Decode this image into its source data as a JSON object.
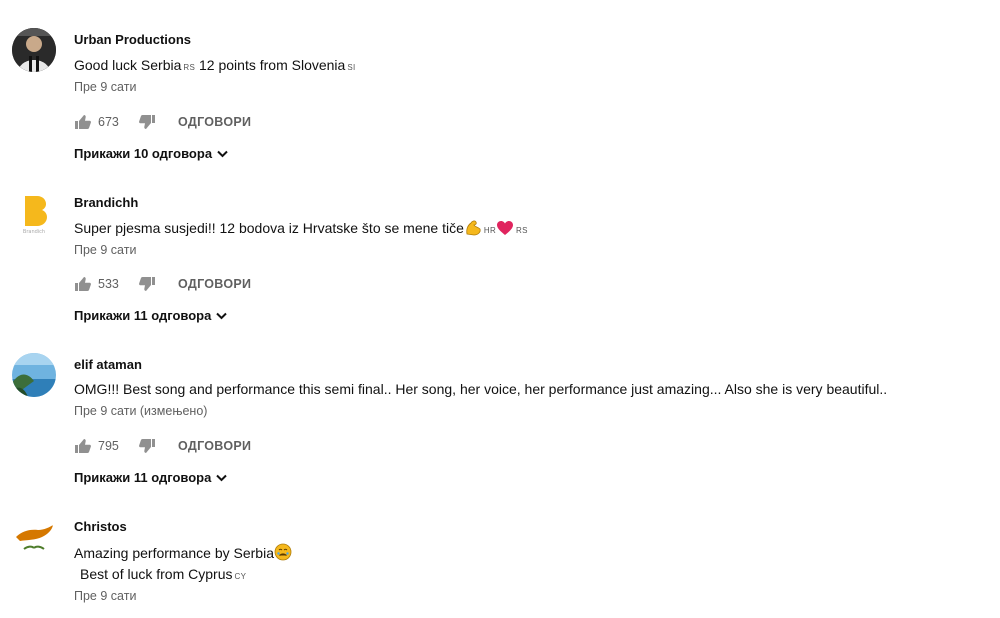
{
  "comments": [
    {
      "author": "Urban Productions",
      "text_parts": [
        "Good luck Serbia",
        "RS",
        " 12 points from Slovenia",
        "SI"
      ],
      "time": "Пре 9 сати",
      "likes": "673",
      "reply_label": "ОДГОВОРИ",
      "replies_label": "Прикажи 10 одговора",
      "avatar_icon": "person-photo-icon"
    },
    {
      "author": "Brandichh",
      "text_parts": [
        "Super pjesma susjedi!! 12 bodova iz Hrvatske što se mene tiče",
        "HR",
        "RS"
      ],
      "time": "Пре 9 сати",
      "likes": "533",
      "reply_label": "ОДГОВОРИ",
      "replies_label": "Прикажи 11 одговора",
      "avatar_icon": "yellow-logo-icon"
    },
    {
      "author": "elif ataman",
      "text": "OMG!!! Best song and performance this semi final.. Her song, her voice, her performance just amazing... Also she is very beautiful..",
      "time": "Пре 9 сати (измењено)",
      "likes": "795",
      "reply_label": "ОДГОВОРИ",
      "replies_label": "Прикажи 11 одговора",
      "avatar_icon": "landscape-photo-icon"
    },
    {
      "author": "Christos",
      "text_line1": "Amazing performance by Serbia",
      "text_line2_parts": [
        "Best of luck from Cyprus",
        "CY"
      ],
      "time": "Пре 9 сати",
      "avatar_icon": "cyprus-flag-icon"
    }
  ],
  "colors": {
    "text": "#111111",
    "meta": "#606060",
    "icon": "#909090",
    "heart": "#e0245e",
    "emoji_yellow": "#f5b81c"
  }
}
